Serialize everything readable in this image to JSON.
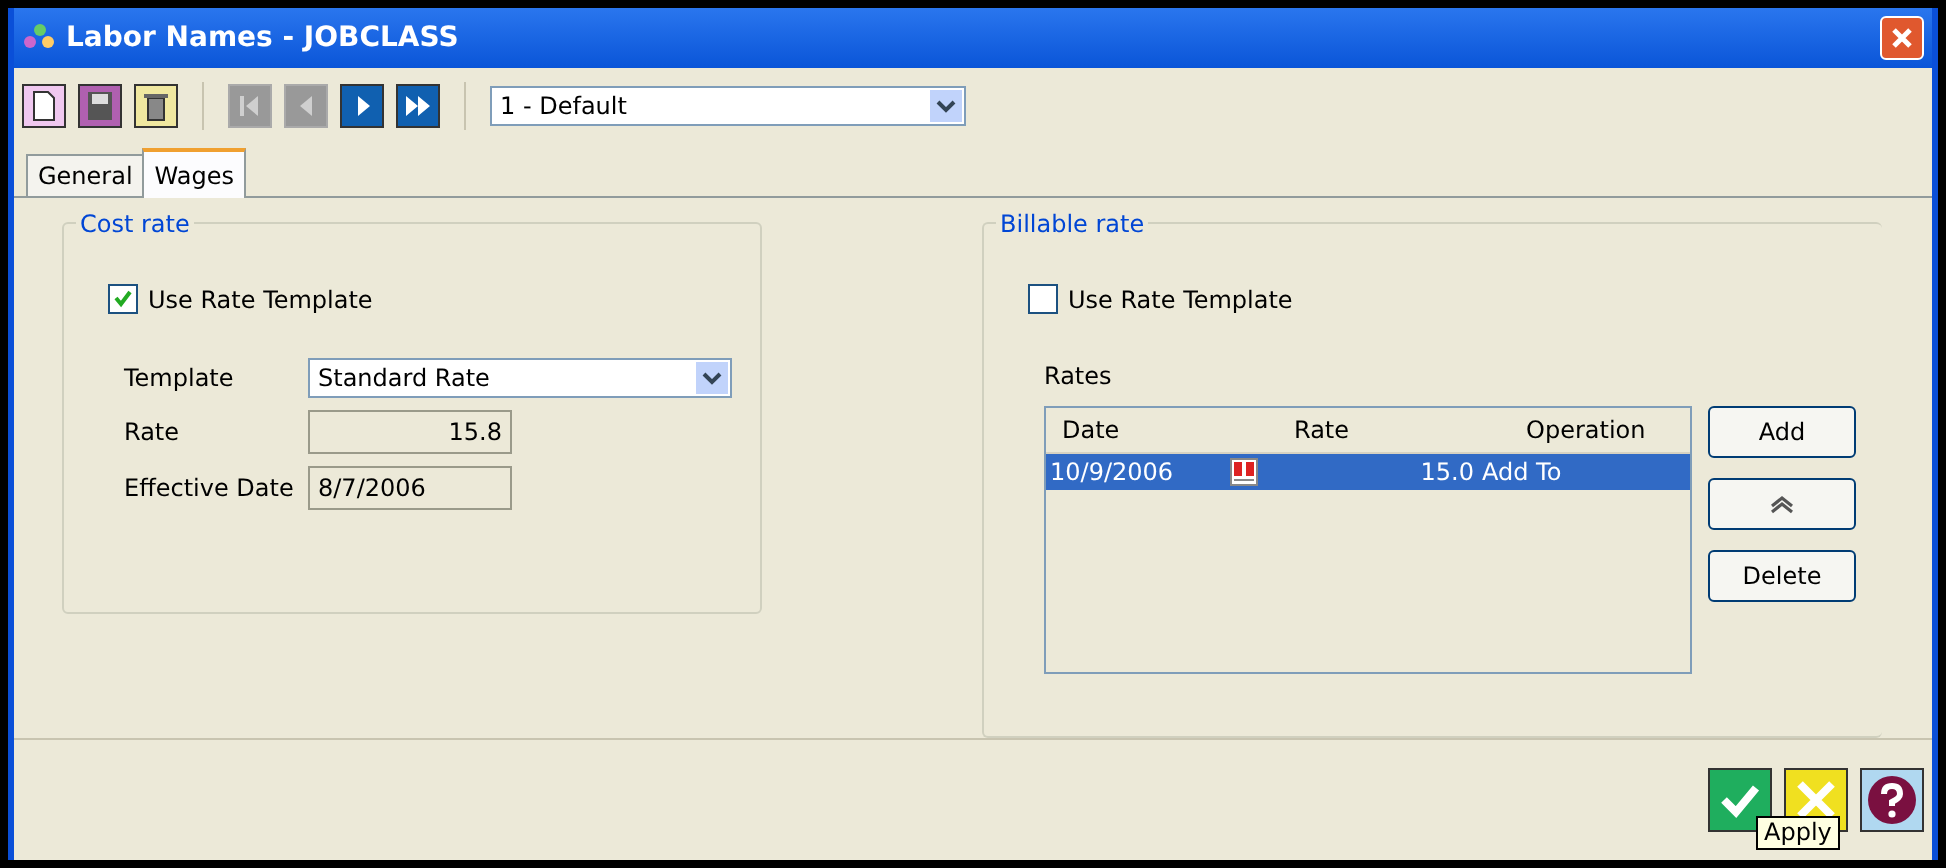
{
  "window": {
    "title": "Labor Names - JOBCLASS"
  },
  "toolbar": {
    "buttons": [
      {
        "kind": "new",
        "disabled": false
      },
      {
        "kind": "save",
        "disabled": false
      },
      {
        "kind": "delete",
        "disabled": false
      },
      {
        "kind": "first",
        "disabled": true
      },
      {
        "kind": "prev",
        "disabled": true
      },
      {
        "kind": "next",
        "disabled": false
      },
      {
        "kind": "last",
        "disabled": false
      }
    ],
    "record": {
      "value": "1 - Default"
    }
  },
  "tabs": [
    {
      "label": "General",
      "selected": false
    },
    {
      "label": "Wages",
      "selected": true
    }
  ],
  "cost_rate": {
    "title": "Cost rate",
    "use_template": {
      "label": "Use Rate Template",
      "checked": true
    },
    "template": {
      "label": "Template",
      "value": "Standard Rate"
    },
    "rate": {
      "label": "Rate",
      "value": "15.8"
    },
    "effective_date": {
      "label": "Effective Date",
      "value": "8/7/2006"
    }
  },
  "billable_rate": {
    "title": "Billable rate",
    "use_template": {
      "label": "Use Rate Template",
      "checked": false
    },
    "rates": {
      "label": "Rates",
      "columns": [
        "Date",
        "Rate",
        "Operation"
      ],
      "rows": [
        {
          "date": "10/9/2006",
          "rate": "15.0",
          "operation": "Add To",
          "selected": true
        }
      ]
    },
    "buttons": [
      {
        "kind": "text",
        "label": "Add"
      },
      {
        "kind": "up"
      },
      {
        "kind": "text",
        "label": "Delete"
      }
    ]
  },
  "footer": {
    "buttons": [
      {
        "kind": "apply"
      },
      {
        "kind": "cancel"
      },
      {
        "kind": "help"
      }
    ],
    "tooltip": "Apply"
  }
}
